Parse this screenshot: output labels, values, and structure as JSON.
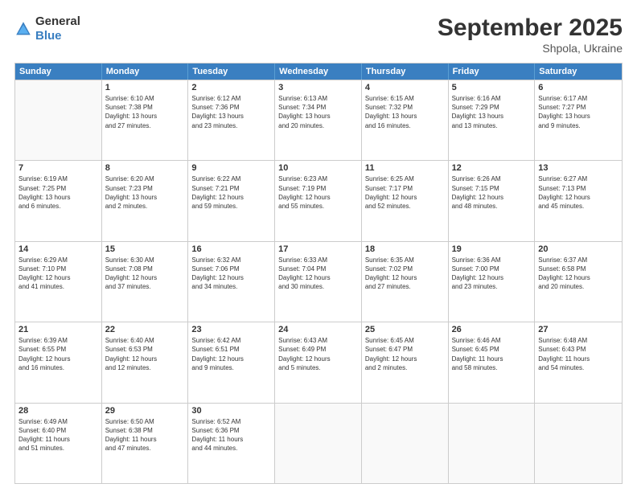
{
  "logo": {
    "general": "General",
    "blue": "Blue"
  },
  "title": "September 2025",
  "location": "Shpola, Ukraine",
  "days": [
    "Sunday",
    "Monday",
    "Tuesday",
    "Wednesday",
    "Thursday",
    "Friday",
    "Saturday"
  ],
  "weeks": [
    [
      {
        "day": "",
        "lines": []
      },
      {
        "day": "1",
        "lines": [
          "Sunrise: 6:10 AM",
          "Sunset: 7:38 PM",
          "Daylight: 13 hours",
          "and 27 minutes."
        ]
      },
      {
        "day": "2",
        "lines": [
          "Sunrise: 6:12 AM",
          "Sunset: 7:36 PM",
          "Daylight: 13 hours",
          "and 23 minutes."
        ]
      },
      {
        "day": "3",
        "lines": [
          "Sunrise: 6:13 AM",
          "Sunset: 7:34 PM",
          "Daylight: 13 hours",
          "and 20 minutes."
        ]
      },
      {
        "day": "4",
        "lines": [
          "Sunrise: 6:15 AM",
          "Sunset: 7:32 PM",
          "Daylight: 13 hours",
          "and 16 minutes."
        ]
      },
      {
        "day": "5",
        "lines": [
          "Sunrise: 6:16 AM",
          "Sunset: 7:29 PM",
          "Daylight: 13 hours",
          "and 13 minutes."
        ]
      },
      {
        "day": "6",
        "lines": [
          "Sunrise: 6:17 AM",
          "Sunset: 7:27 PM",
          "Daylight: 13 hours",
          "and 9 minutes."
        ]
      }
    ],
    [
      {
        "day": "7",
        "lines": [
          "Sunrise: 6:19 AM",
          "Sunset: 7:25 PM",
          "Daylight: 13 hours",
          "and 6 minutes."
        ]
      },
      {
        "day": "8",
        "lines": [
          "Sunrise: 6:20 AM",
          "Sunset: 7:23 PM",
          "Daylight: 13 hours",
          "and 2 minutes."
        ]
      },
      {
        "day": "9",
        "lines": [
          "Sunrise: 6:22 AM",
          "Sunset: 7:21 PM",
          "Daylight: 12 hours",
          "and 59 minutes."
        ]
      },
      {
        "day": "10",
        "lines": [
          "Sunrise: 6:23 AM",
          "Sunset: 7:19 PM",
          "Daylight: 12 hours",
          "and 55 minutes."
        ]
      },
      {
        "day": "11",
        "lines": [
          "Sunrise: 6:25 AM",
          "Sunset: 7:17 PM",
          "Daylight: 12 hours",
          "and 52 minutes."
        ]
      },
      {
        "day": "12",
        "lines": [
          "Sunrise: 6:26 AM",
          "Sunset: 7:15 PM",
          "Daylight: 12 hours",
          "and 48 minutes."
        ]
      },
      {
        "day": "13",
        "lines": [
          "Sunrise: 6:27 AM",
          "Sunset: 7:13 PM",
          "Daylight: 12 hours",
          "and 45 minutes."
        ]
      }
    ],
    [
      {
        "day": "14",
        "lines": [
          "Sunrise: 6:29 AM",
          "Sunset: 7:10 PM",
          "Daylight: 12 hours",
          "and 41 minutes."
        ]
      },
      {
        "day": "15",
        "lines": [
          "Sunrise: 6:30 AM",
          "Sunset: 7:08 PM",
          "Daylight: 12 hours",
          "and 37 minutes."
        ]
      },
      {
        "day": "16",
        "lines": [
          "Sunrise: 6:32 AM",
          "Sunset: 7:06 PM",
          "Daylight: 12 hours",
          "and 34 minutes."
        ]
      },
      {
        "day": "17",
        "lines": [
          "Sunrise: 6:33 AM",
          "Sunset: 7:04 PM",
          "Daylight: 12 hours",
          "and 30 minutes."
        ]
      },
      {
        "day": "18",
        "lines": [
          "Sunrise: 6:35 AM",
          "Sunset: 7:02 PM",
          "Daylight: 12 hours",
          "and 27 minutes."
        ]
      },
      {
        "day": "19",
        "lines": [
          "Sunrise: 6:36 AM",
          "Sunset: 7:00 PM",
          "Daylight: 12 hours",
          "and 23 minutes."
        ]
      },
      {
        "day": "20",
        "lines": [
          "Sunrise: 6:37 AM",
          "Sunset: 6:58 PM",
          "Daylight: 12 hours",
          "and 20 minutes."
        ]
      }
    ],
    [
      {
        "day": "21",
        "lines": [
          "Sunrise: 6:39 AM",
          "Sunset: 6:55 PM",
          "Daylight: 12 hours",
          "and 16 minutes."
        ]
      },
      {
        "day": "22",
        "lines": [
          "Sunrise: 6:40 AM",
          "Sunset: 6:53 PM",
          "Daylight: 12 hours",
          "and 12 minutes."
        ]
      },
      {
        "day": "23",
        "lines": [
          "Sunrise: 6:42 AM",
          "Sunset: 6:51 PM",
          "Daylight: 12 hours",
          "and 9 minutes."
        ]
      },
      {
        "day": "24",
        "lines": [
          "Sunrise: 6:43 AM",
          "Sunset: 6:49 PM",
          "Daylight: 12 hours",
          "and 5 minutes."
        ]
      },
      {
        "day": "25",
        "lines": [
          "Sunrise: 6:45 AM",
          "Sunset: 6:47 PM",
          "Daylight: 12 hours",
          "and 2 minutes."
        ]
      },
      {
        "day": "26",
        "lines": [
          "Sunrise: 6:46 AM",
          "Sunset: 6:45 PM",
          "Daylight: 11 hours",
          "and 58 minutes."
        ]
      },
      {
        "day": "27",
        "lines": [
          "Sunrise: 6:48 AM",
          "Sunset: 6:43 PM",
          "Daylight: 11 hours",
          "and 54 minutes."
        ]
      }
    ],
    [
      {
        "day": "28",
        "lines": [
          "Sunrise: 6:49 AM",
          "Sunset: 6:40 PM",
          "Daylight: 11 hours",
          "and 51 minutes."
        ]
      },
      {
        "day": "29",
        "lines": [
          "Sunrise: 6:50 AM",
          "Sunset: 6:38 PM",
          "Daylight: 11 hours",
          "and 47 minutes."
        ]
      },
      {
        "day": "30",
        "lines": [
          "Sunrise: 6:52 AM",
          "Sunset: 6:36 PM",
          "Daylight: 11 hours",
          "and 44 minutes."
        ]
      },
      {
        "day": "",
        "lines": []
      },
      {
        "day": "",
        "lines": []
      },
      {
        "day": "",
        "lines": []
      },
      {
        "day": "",
        "lines": []
      }
    ]
  ]
}
